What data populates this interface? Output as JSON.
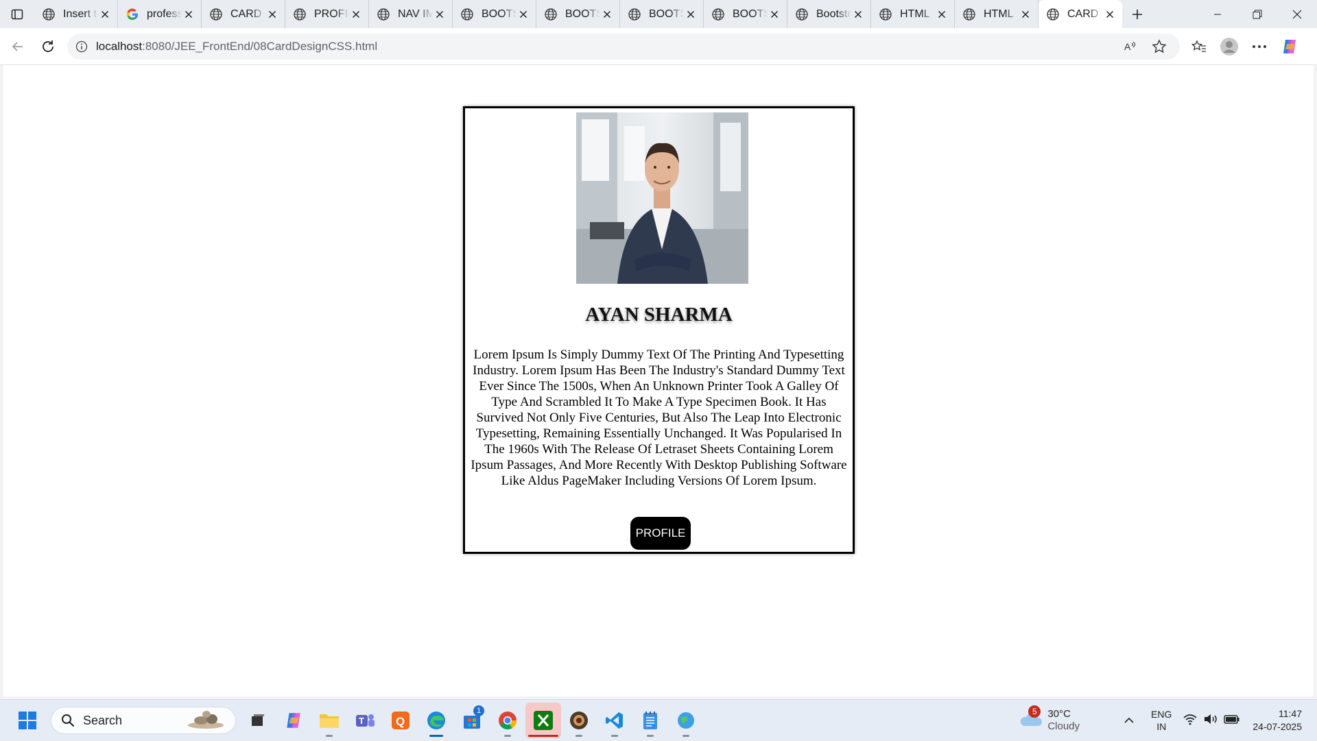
{
  "browser": {
    "tabs": [
      {
        "title": "Insert t",
        "icon": "globe-icon"
      },
      {
        "title": "profess",
        "icon": "google-icon"
      },
      {
        "title": "CARD D",
        "icon": "globe-icon"
      },
      {
        "title": "PROFIL",
        "icon": "globe-icon"
      },
      {
        "title": "NAV IM",
        "icon": "globe-icon"
      },
      {
        "title": "BOOTS",
        "icon": "globe-icon"
      },
      {
        "title": "BOOTS",
        "icon": "globe-icon"
      },
      {
        "title": "BOOTS",
        "icon": "globe-icon"
      },
      {
        "title": "BOOTS",
        "icon": "globe-icon"
      },
      {
        "title": "Bootstr",
        "icon": "globe-icon"
      },
      {
        "title": "HTML",
        "icon": "globe-icon"
      },
      {
        "title": "HTML",
        "icon": "globe-icon"
      },
      {
        "title": "CARD D",
        "icon": "globe-icon",
        "active": true
      }
    ],
    "address": {
      "host": "localhost",
      "path": ":8080/JEE_FrontEnd/08CardDesignCSS.html"
    }
  },
  "card": {
    "name": "AYAN SHARMA",
    "description": "Lorem Ipsum Is Simply Dummy Text Of The Printing And Typesetting Industry. Lorem Ipsum Has Been The Industry's Standard Dummy Text Ever Since The 1500s, When An Unknown Printer Took A Galley Of Type And Scrambled It To Make A Type Specimen Book. It Has Survived Not Only Five Centuries, But Also The Leap Into Electronic Typesetting, Remaining Essentially Unchanged. It Was Popularised In The 1960s With The Release Of Letraset Sheets Containing Lorem Ipsum Passages, And More Recently With Desktop Publishing Software Like Aldus PageMaker Including Versions Of Lorem Ipsum.",
    "button_label": "PROFILE"
  },
  "taskbar": {
    "search_label": "Search",
    "store_badge": "1",
    "weather": {
      "temp": "30°C",
      "condition": "Cloudy",
      "badge": "5"
    },
    "language": {
      "line1": "ENG",
      "line2": "IN"
    },
    "clock": {
      "time": "11:47",
      "date": "24-07-2025"
    }
  },
  "colors": {
    "accent": "#0067c0",
    "button_bg": "#000000",
    "card_border": "#000000"
  }
}
